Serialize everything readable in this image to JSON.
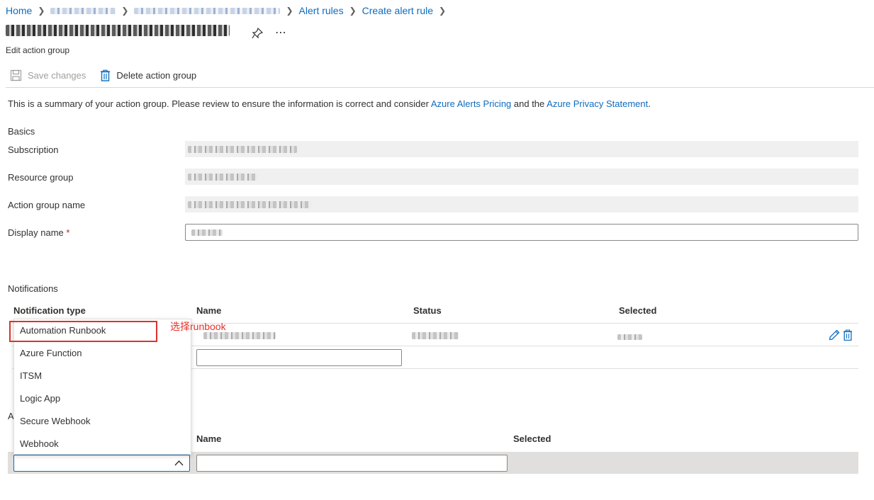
{
  "breadcrumb": {
    "home": "Home",
    "alert_rules": "Alert rules",
    "create_alert_rule": "Create alert rule"
  },
  "header": {
    "subtitle": "Edit action group"
  },
  "toolbar": {
    "save_label": "Save changes",
    "delete_label": "Delete action group"
  },
  "summary": {
    "prefix": "This is a summary of your action group. Please review to ensure the information is correct and consider ",
    "pricing_link": "Azure Alerts Pricing",
    "middle": " and the ",
    "privacy_link": "Azure Privacy Statement",
    "suffix": "."
  },
  "basics": {
    "heading": "Basics",
    "subscription_label": "Subscription",
    "resource_group_label": "Resource group",
    "action_group_name_label": "Action group name",
    "display_name_label": "Display name",
    "required_mark": "*"
  },
  "notifications": {
    "heading": "Notifications",
    "columns": [
      "Notification type",
      "Name",
      "Status",
      "Selected"
    ]
  },
  "dropdown": {
    "options": [
      "Automation Runbook",
      "Azure Function",
      "ITSM",
      "Logic App",
      "Secure Webhook",
      "Webhook"
    ],
    "annotation": "选择runbook"
  },
  "actions": {
    "heading_partial": "A",
    "columns": [
      "Name",
      "Selected"
    ]
  },
  "colors": {
    "link": "#0f6cbd",
    "annotation": "#e8312a",
    "required": "#a4262c"
  }
}
